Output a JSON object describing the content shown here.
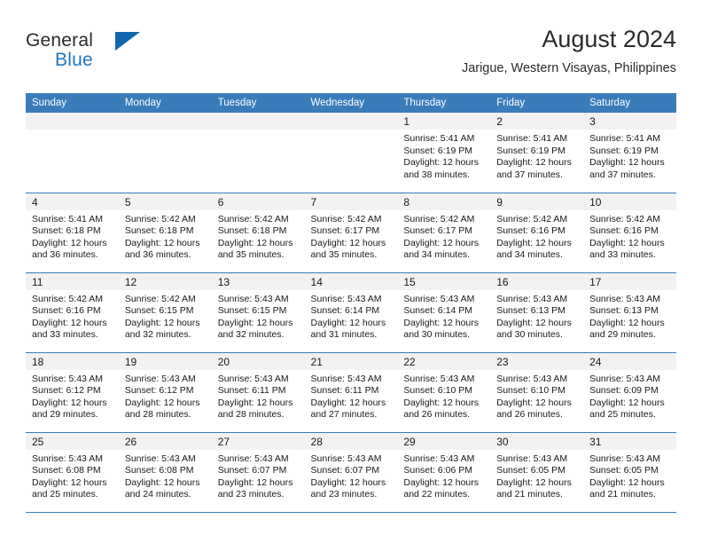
{
  "brand": {
    "word1": "General",
    "word2": "Blue",
    "accent_color": "#1167ad"
  },
  "header": {
    "title": "August 2024",
    "subtitle": "Jarigue, Western Visayas, Philippines"
  },
  "calendar": {
    "header_bg": "#3a7cba",
    "daynum_bg": "#f2f2f2",
    "weekday_headers": [
      "Sunday",
      "Monday",
      "Tuesday",
      "Wednesday",
      "Thursday",
      "Friday",
      "Saturday"
    ],
    "weeks": [
      [
        {
          "day": "",
          "sunrise": "",
          "sunset": "",
          "daylight_line1": "",
          "daylight_line2": ""
        },
        {
          "day": "",
          "sunrise": "",
          "sunset": "",
          "daylight_line1": "",
          "daylight_line2": ""
        },
        {
          "day": "",
          "sunrise": "",
          "sunset": "",
          "daylight_line1": "",
          "daylight_line2": ""
        },
        {
          "day": "",
          "sunrise": "",
          "sunset": "",
          "daylight_line1": "",
          "daylight_line2": ""
        },
        {
          "day": "1",
          "sunrise": "Sunrise: 5:41 AM",
          "sunset": "Sunset: 6:19 PM",
          "daylight_line1": "Daylight: 12 hours",
          "daylight_line2": "and 38 minutes."
        },
        {
          "day": "2",
          "sunrise": "Sunrise: 5:41 AM",
          "sunset": "Sunset: 6:19 PM",
          "daylight_line1": "Daylight: 12 hours",
          "daylight_line2": "and 37 minutes."
        },
        {
          "day": "3",
          "sunrise": "Sunrise: 5:41 AM",
          "sunset": "Sunset: 6:19 PM",
          "daylight_line1": "Daylight: 12 hours",
          "daylight_line2": "and 37 minutes."
        }
      ],
      [
        {
          "day": "4",
          "sunrise": "Sunrise: 5:41 AM",
          "sunset": "Sunset: 6:18 PM",
          "daylight_line1": "Daylight: 12 hours",
          "daylight_line2": "and 36 minutes."
        },
        {
          "day": "5",
          "sunrise": "Sunrise: 5:42 AM",
          "sunset": "Sunset: 6:18 PM",
          "daylight_line1": "Daylight: 12 hours",
          "daylight_line2": "and 36 minutes."
        },
        {
          "day": "6",
          "sunrise": "Sunrise: 5:42 AM",
          "sunset": "Sunset: 6:18 PM",
          "daylight_line1": "Daylight: 12 hours",
          "daylight_line2": "and 35 minutes."
        },
        {
          "day": "7",
          "sunrise": "Sunrise: 5:42 AM",
          "sunset": "Sunset: 6:17 PM",
          "daylight_line1": "Daylight: 12 hours",
          "daylight_line2": "and 35 minutes."
        },
        {
          "day": "8",
          "sunrise": "Sunrise: 5:42 AM",
          "sunset": "Sunset: 6:17 PM",
          "daylight_line1": "Daylight: 12 hours",
          "daylight_line2": "and 34 minutes."
        },
        {
          "day": "9",
          "sunrise": "Sunrise: 5:42 AM",
          "sunset": "Sunset: 6:16 PM",
          "daylight_line1": "Daylight: 12 hours",
          "daylight_line2": "and 34 minutes."
        },
        {
          "day": "10",
          "sunrise": "Sunrise: 5:42 AM",
          "sunset": "Sunset: 6:16 PM",
          "daylight_line1": "Daylight: 12 hours",
          "daylight_line2": "and 33 minutes."
        }
      ],
      [
        {
          "day": "11",
          "sunrise": "Sunrise: 5:42 AM",
          "sunset": "Sunset: 6:16 PM",
          "daylight_line1": "Daylight: 12 hours",
          "daylight_line2": "and 33 minutes."
        },
        {
          "day": "12",
          "sunrise": "Sunrise: 5:42 AM",
          "sunset": "Sunset: 6:15 PM",
          "daylight_line1": "Daylight: 12 hours",
          "daylight_line2": "and 32 minutes."
        },
        {
          "day": "13",
          "sunrise": "Sunrise: 5:43 AM",
          "sunset": "Sunset: 6:15 PM",
          "daylight_line1": "Daylight: 12 hours",
          "daylight_line2": "and 32 minutes."
        },
        {
          "day": "14",
          "sunrise": "Sunrise: 5:43 AM",
          "sunset": "Sunset: 6:14 PM",
          "daylight_line1": "Daylight: 12 hours",
          "daylight_line2": "and 31 minutes."
        },
        {
          "day": "15",
          "sunrise": "Sunrise: 5:43 AM",
          "sunset": "Sunset: 6:14 PM",
          "daylight_line1": "Daylight: 12 hours",
          "daylight_line2": "and 30 minutes."
        },
        {
          "day": "16",
          "sunrise": "Sunrise: 5:43 AM",
          "sunset": "Sunset: 6:13 PM",
          "daylight_line1": "Daylight: 12 hours",
          "daylight_line2": "and 30 minutes."
        },
        {
          "day": "17",
          "sunrise": "Sunrise: 5:43 AM",
          "sunset": "Sunset: 6:13 PM",
          "daylight_line1": "Daylight: 12 hours",
          "daylight_line2": "and 29 minutes."
        }
      ],
      [
        {
          "day": "18",
          "sunrise": "Sunrise: 5:43 AM",
          "sunset": "Sunset: 6:12 PM",
          "daylight_line1": "Daylight: 12 hours",
          "daylight_line2": "and 29 minutes."
        },
        {
          "day": "19",
          "sunrise": "Sunrise: 5:43 AM",
          "sunset": "Sunset: 6:12 PM",
          "daylight_line1": "Daylight: 12 hours",
          "daylight_line2": "and 28 minutes."
        },
        {
          "day": "20",
          "sunrise": "Sunrise: 5:43 AM",
          "sunset": "Sunset: 6:11 PM",
          "daylight_line1": "Daylight: 12 hours",
          "daylight_line2": "and 28 minutes."
        },
        {
          "day": "21",
          "sunrise": "Sunrise: 5:43 AM",
          "sunset": "Sunset: 6:11 PM",
          "daylight_line1": "Daylight: 12 hours",
          "daylight_line2": "and 27 minutes."
        },
        {
          "day": "22",
          "sunrise": "Sunrise: 5:43 AM",
          "sunset": "Sunset: 6:10 PM",
          "daylight_line1": "Daylight: 12 hours",
          "daylight_line2": "and 26 minutes."
        },
        {
          "day": "23",
          "sunrise": "Sunrise: 5:43 AM",
          "sunset": "Sunset: 6:10 PM",
          "daylight_line1": "Daylight: 12 hours",
          "daylight_line2": "and 26 minutes."
        },
        {
          "day": "24",
          "sunrise": "Sunrise: 5:43 AM",
          "sunset": "Sunset: 6:09 PM",
          "daylight_line1": "Daylight: 12 hours",
          "daylight_line2": "and 25 minutes."
        }
      ],
      [
        {
          "day": "25",
          "sunrise": "Sunrise: 5:43 AM",
          "sunset": "Sunset: 6:08 PM",
          "daylight_line1": "Daylight: 12 hours",
          "daylight_line2": "and 25 minutes."
        },
        {
          "day": "26",
          "sunrise": "Sunrise: 5:43 AM",
          "sunset": "Sunset: 6:08 PM",
          "daylight_line1": "Daylight: 12 hours",
          "daylight_line2": "and 24 minutes."
        },
        {
          "day": "27",
          "sunrise": "Sunrise: 5:43 AM",
          "sunset": "Sunset: 6:07 PM",
          "daylight_line1": "Daylight: 12 hours",
          "daylight_line2": "and 23 minutes."
        },
        {
          "day": "28",
          "sunrise": "Sunrise: 5:43 AM",
          "sunset": "Sunset: 6:07 PM",
          "daylight_line1": "Daylight: 12 hours",
          "daylight_line2": "and 23 minutes."
        },
        {
          "day": "29",
          "sunrise": "Sunrise: 5:43 AM",
          "sunset": "Sunset: 6:06 PM",
          "daylight_line1": "Daylight: 12 hours",
          "daylight_line2": "and 22 minutes."
        },
        {
          "day": "30",
          "sunrise": "Sunrise: 5:43 AM",
          "sunset": "Sunset: 6:05 PM",
          "daylight_line1": "Daylight: 12 hours",
          "daylight_line2": "and 21 minutes."
        },
        {
          "day": "31",
          "sunrise": "Sunrise: 5:43 AM",
          "sunset": "Sunset: 6:05 PM",
          "daylight_line1": "Daylight: 12 hours",
          "daylight_line2": "and 21 minutes."
        }
      ]
    ]
  }
}
